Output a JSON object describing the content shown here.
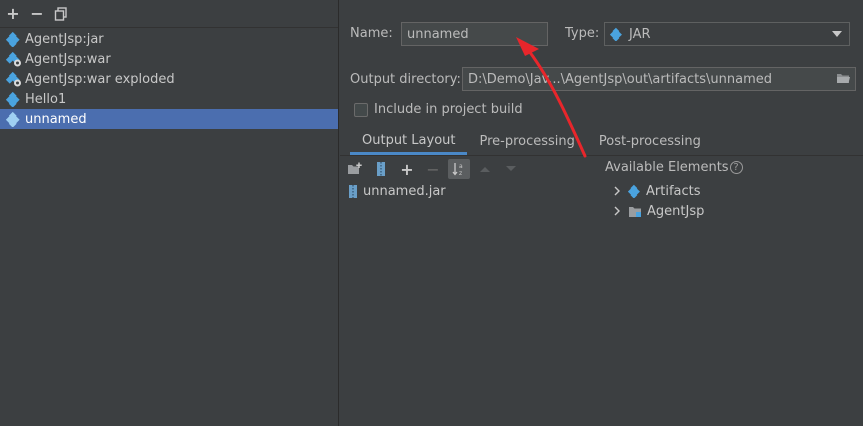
{
  "left_panel": {
    "toolbar": {
      "add": "+",
      "remove": "−"
    },
    "artifacts": [
      {
        "label": "AgentJsp:jar",
        "icon": "jar-artifact-icon"
      },
      {
        "label": "AgentJsp:war",
        "icon": "war-artifact-icon"
      },
      {
        "label": "AgentJsp:war exploded",
        "icon": "war-exploded-artifact-icon"
      },
      {
        "label": "Hello1",
        "icon": "artifact-icon"
      },
      {
        "label": "unnamed",
        "icon": "artifact-icon",
        "selected": true
      }
    ]
  },
  "form": {
    "name_label": "Name:",
    "name_value": "unnamed",
    "type_label": "Type:",
    "type_value": "JAR",
    "output_dir_label": "Output directory:",
    "output_dir_value": "D:\\Demo\\Jav...\\AgentJsp\\out\\artifacts\\unnamed",
    "include_label": "Include in project build",
    "include_checked": false
  },
  "tabs": [
    {
      "label": "Output Layout",
      "active": true
    },
    {
      "label": "Pre-processing",
      "active": false
    },
    {
      "label": "Post-processing",
      "active": false
    }
  ],
  "layout_toolbar": {
    "add": "+",
    "remove": "−"
  },
  "layout_tree": [
    {
      "label": "unnamed.jar",
      "icon": "jar-file-icon"
    }
  ],
  "available": {
    "label": "Available Elements",
    "help": "?",
    "items": [
      {
        "label": "Artifacts",
        "icon": "artifacts-icon"
      },
      {
        "label": "AgentJsp",
        "icon": "module-folder-icon"
      }
    ]
  },
  "colors": {
    "background": "#3c3f41",
    "selection": "#4b6eaf",
    "accent_tab": "#4a88c7",
    "annotation_arrow": "#e8262b",
    "artifact_icon": "#4aa3df"
  }
}
